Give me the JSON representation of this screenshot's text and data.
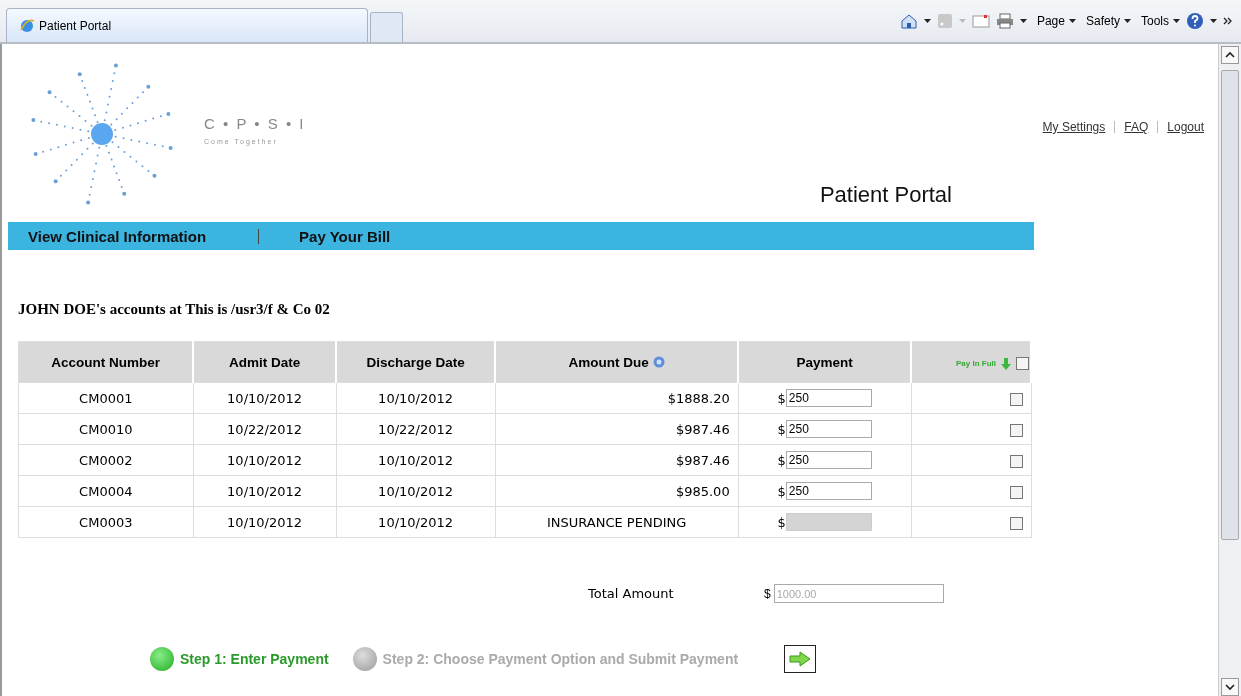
{
  "browser": {
    "tab_title": "Patient Portal",
    "toolbar": [
      "Page",
      "Safety",
      "Tools"
    ]
  },
  "logo": {
    "name": "C • P • S • I",
    "tagline": "Come Together"
  },
  "top_links": [
    "My Settings",
    "FAQ",
    "Logout"
  ],
  "page_title": "Patient Portal",
  "nav": [
    "View Clinical Information",
    "Pay Your Bill"
  ],
  "heading": "JOHN DOE's accounts at This is /usr3/f & Co 02",
  "table": {
    "columns": [
      "Account Number",
      "Admit Date",
      "Discharge Date",
      "Amount Due",
      "Payment",
      "Pay In Full"
    ],
    "pay_in_full_checked": false,
    "rows": [
      {
        "account": "CM0001",
        "admit": "10/10/2012",
        "discharge": "10/10/2012",
        "amount_due": "$1888.20",
        "currency": "$",
        "payment": "250",
        "payment_disabled": false,
        "checked": false
      },
      {
        "account": "CM0010",
        "admit": "10/22/2012",
        "discharge": "10/22/2012",
        "amount_due": "$987.46",
        "currency": "$",
        "payment": "250",
        "payment_disabled": false,
        "checked": false
      },
      {
        "account": "CM0002",
        "admit": "10/10/2012",
        "discharge": "10/10/2012",
        "amount_due": "$987.46",
        "currency": "$",
        "payment": "250",
        "payment_disabled": false,
        "checked": false
      },
      {
        "account": "CM0004",
        "admit": "10/10/2012",
        "discharge": "10/10/2012",
        "amount_due": "$985.00",
        "currency": "$",
        "payment": "250",
        "payment_disabled": false,
        "checked": false
      },
      {
        "account": "CM0003",
        "admit": "10/10/2012",
        "discharge": "10/10/2012",
        "amount_due": "INSURANCE PENDING",
        "currency": "$",
        "payment_disabled": true,
        "checked": false
      }
    ]
  },
  "total": {
    "label": "Total Amount",
    "currency": "$",
    "placeholder": "1000.00"
  },
  "steps": [
    {
      "label": "Step 1: Enter Payment",
      "selected": true
    },
    {
      "label": "Step 2: Choose Payment Option and Submit Payment",
      "selected": false
    }
  ]
}
